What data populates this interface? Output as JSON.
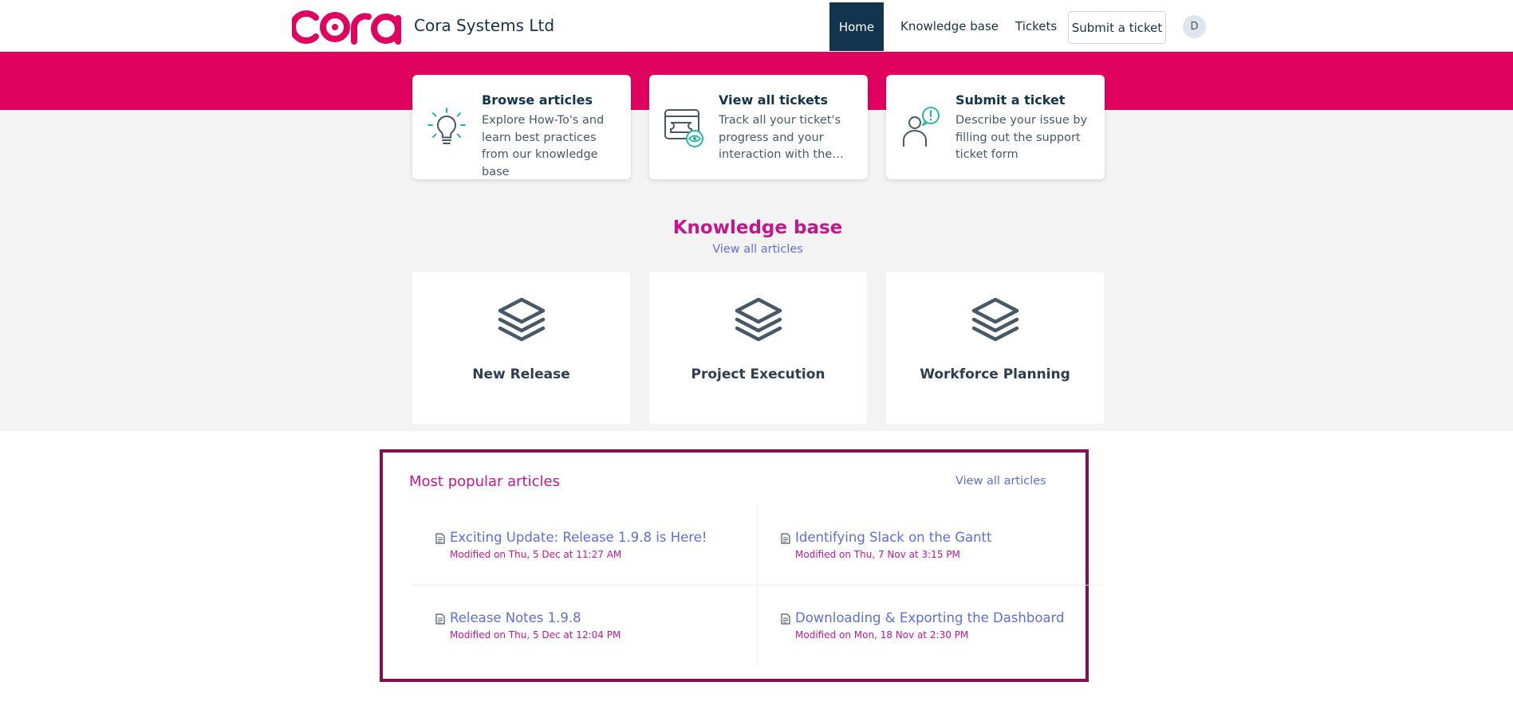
{
  "header": {
    "logo_text": "cora",
    "company_name": "Cora Systems Ltd",
    "nav": {
      "home": "Home",
      "knowledge_base": "Knowledge base",
      "tickets": "Tickets",
      "submit_ticket": "Submit a ticket"
    },
    "avatar_initial": "D"
  },
  "quick_cards": [
    {
      "title": "Browse articles",
      "description": "Explore How-To's and learn best practices from our knowledge base",
      "icon": "lightbulb-icon"
    },
    {
      "title": "View all tickets",
      "description": "Track all your ticket's progress and your interaction with the…",
      "icon": "ticket-eye-icon"
    },
    {
      "title": "Submit a ticket",
      "description": "Describe your issue by filling out the support ticket form",
      "icon": "person-alert-icon"
    }
  ],
  "knowledge_base": {
    "title": "Knowledge base",
    "view_all": "View all articles",
    "categories": [
      {
        "label": "New Release",
        "icon": "layers-icon"
      },
      {
        "label": "Project Execution",
        "icon": "layers-icon"
      },
      {
        "label": "Workforce Planning",
        "icon": "layers-icon"
      }
    ]
  },
  "popular": {
    "title": "Most popular articles",
    "view_all": "View all articles",
    "articles": [
      {
        "title": "Exciting Update: Release 1.9.8 is Here!",
        "modified": "Modified on Thu, 5 Dec at 11:27 AM"
      },
      {
        "title": "Identifying Slack on the Gantt",
        "modified": "Modified on Thu, 7 Nov at 3:15 PM"
      },
      {
        "title": "Release Notes 1.9.8",
        "modified": "Modified on Thu, 5 Dec at 12:04 PM"
      },
      {
        "title": "Downloading & Exporting the Dashboard",
        "modified": "Modified on Mon, 18 Nov at 2:30 PM"
      }
    ]
  },
  "colors": {
    "brand_pink": "#e0025f",
    "nav_active": "#12344d",
    "heading_magenta": "#c2188f",
    "link_blue": "#5e6ee0",
    "popular_border": "#84104f",
    "icon_teal": "#2bb5a0"
  }
}
